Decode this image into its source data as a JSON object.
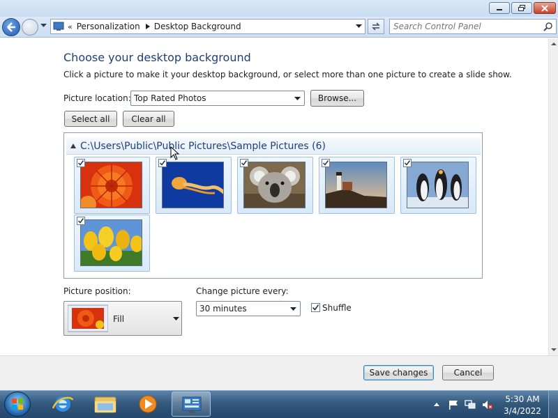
{
  "window": {
    "minimize_icon": "minimize-icon",
    "maximize_icon": "restore-icon",
    "close_icon": "close-icon"
  },
  "navbar": {
    "breadcrumb": [
      "Personalization",
      "Desktop Background"
    ],
    "search_placeholder": "Search Control Panel"
  },
  "main": {
    "heading": "Choose your desktop background",
    "description": "Click a picture to make it your desktop background, or select more than one picture to create a slide show.",
    "picture_location_label": "Picture location:",
    "picture_location_value": "Top Rated Photos",
    "browse_label": "Browse...",
    "select_all_label": "Select all",
    "clear_all_label": "Clear all",
    "group_header": "C:\\Users\\Public\\Public Pictures\\Sample Pictures (6)",
    "thumbnails": [
      {
        "name": "chrysanthemum",
        "checked": true
      },
      {
        "name": "jellyfish",
        "checked": true
      },
      {
        "name": "koala",
        "checked": true
      },
      {
        "name": "lighthouse",
        "checked": true
      },
      {
        "name": "penguins",
        "checked": true
      },
      {
        "name": "tulips",
        "checked": true
      }
    ],
    "picture_position_label": "Picture position:",
    "picture_position_value": "Fill",
    "change_picture_label": "Change picture every:",
    "change_picture_value": "30 minutes",
    "shuffle_label": "Shuffle",
    "shuffle_checked": true
  },
  "footer": {
    "save_label": "Save changes",
    "cancel_label": "Cancel"
  },
  "taskbar": {
    "items": [
      "start-orb",
      "internet-explorer-icon",
      "windows-explorer-icon",
      "media-player-icon",
      "control-panel-icon"
    ],
    "time": "5:30 AM",
    "date": "3/4/2022"
  }
}
